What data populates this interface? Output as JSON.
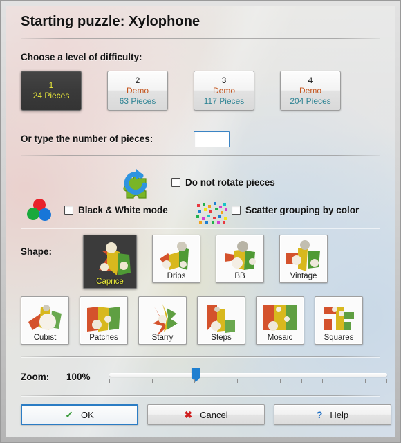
{
  "dialog": {
    "title": "Starting puzzle: Xylophone"
  },
  "difficulty": {
    "label": "Choose a level of difficulty:",
    "options": [
      {
        "number": "1",
        "demo": "",
        "pieces": "24 Pieces",
        "selected": true
      },
      {
        "number": "2",
        "demo": "Demo",
        "pieces": "63 Pieces",
        "selected": false
      },
      {
        "number": "3",
        "demo": "Demo",
        "pieces": "117 Pieces",
        "selected": false
      },
      {
        "number": "4",
        "demo": "Demo",
        "pieces": "204 Pieces",
        "selected": false
      }
    ]
  },
  "custom_pieces": {
    "label": "Or type the number of pieces:",
    "value": "",
    "placeholder": ""
  },
  "options": {
    "rotate": {
      "label": "Do not rotate pieces",
      "checked": false,
      "icon": "rotate-puzzle-piece-icon"
    },
    "bw": {
      "label": "Black & White mode",
      "checked": false,
      "icon": "rgb-circles-icon"
    },
    "scatter": {
      "label": "Scatter grouping by color",
      "checked": false,
      "icon": "color-dots-icon"
    }
  },
  "shape": {
    "label": "Shape:",
    "row1": [
      {
        "name": "Caprice",
        "selected": true
      },
      {
        "name": "Drips",
        "selected": false
      },
      {
        "name": "BB",
        "selected": false
      },
      {
        "name": "Vintage",
        "selected": false
      }
    ],
    "row2": [
      {
        "name": "Cubist",
        "selected": false
      },
      {
        "name": "Patches",
        "selected": false
      },
      {
        "name": "Starry",
        "selected": false
      },
      {
        "name": "Steps",
        "selected": false
      },
      {
        "name": "Mosaic",
        "selected": false
      },
      {
        "name": "Squares",
        "selected": false
      }
    ]
  },
  "zoom": {
    "label": "Zoom:",
    "value": "100%",
    "percent": 31,
    "tick_count": 14
  },
  "buttons": {
    "ok": {
      "label": "OK",
      "icon": "check-icon",
      "glyph": "✓",
      "color": "#3a9b3a",
      "focused": true
    },
    "cancel": {
      "label": "Cancel",
      "icon": "red-x-icon",
      "glyph": "✖",
      "color": "#cf1f1f",
      "focused": false
    },
    "help": {
      "label": "Help",
      "icon": "question-mark-icon",
      "glyph": "?",
      "color": "#1f6fc4",
      "focused": false
    }
  },
  "colors": {
    "selected_bg": "#3a3a3a",
    "selected_text": "#e8e83a",
    "demo_text": "#c4561f",
    "pieces_text": "#2f8494",
    "accent_blue": "#2b7cc4"
  }
}
